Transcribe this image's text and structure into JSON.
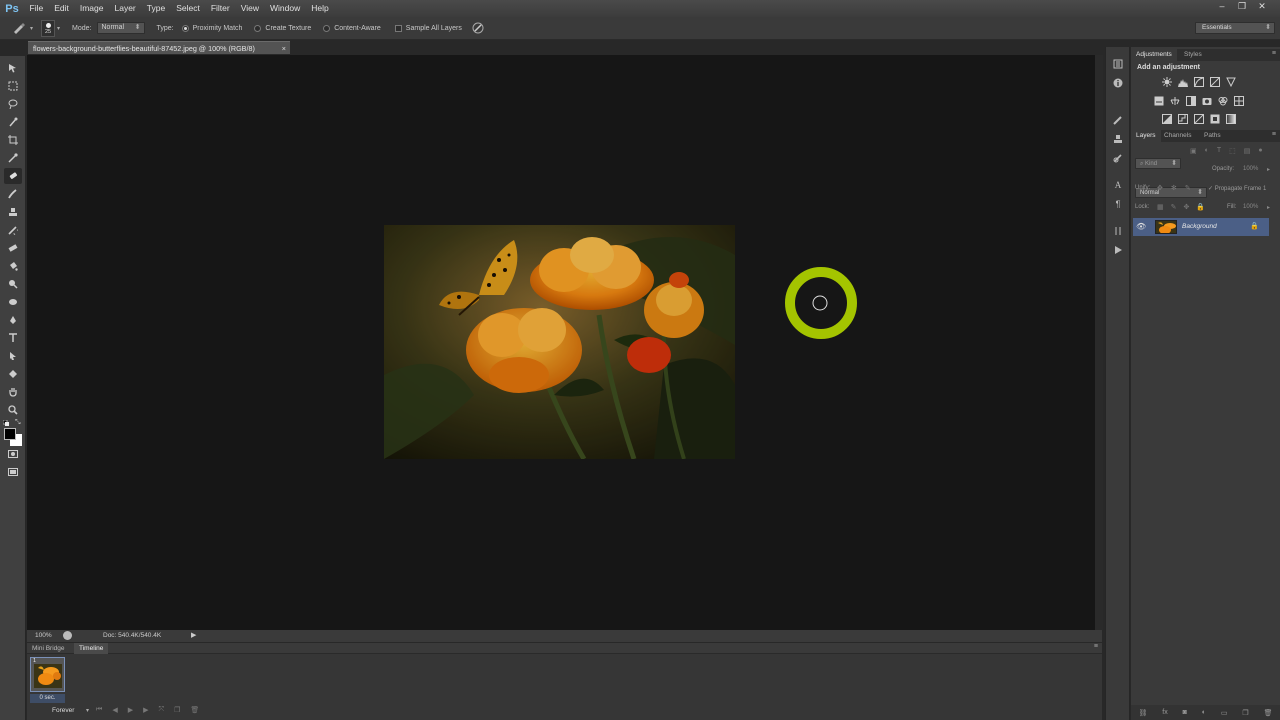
{
  "app": {
    "logo": "Ps"
  },
  "menu": [
    "File",
    "Edit",
    "Image",
    "Layer",
    "Type",
    "Select",
    "Filter",
    "View",
    "Window",
    "Help"
  ],
  "options": {
    "brush_size": "25",
    "mode_label": "Mode:",
    "mode_value": "Normal",
    "type_label": "Type:",
    "type_options": [
      "Proximity Match",
      "Create Texture",
      "Content-Aware"
    ],
    "sample_all_layers": "Sample All Layers",
    "workspace": "Essentials"
  },
  "document": {
    "tab_title": "flowers-background-butterflies-beautiful-87452.jpeg @ 100% (RGB/8)",
    "close": "×"
  },
  "status": {
    "zoom": "100%",
    "doc_size": "Doc: 540.4K/540.4K"
  },
  "bottom_panel": {
    "tabs": [
      "Mini Bridge",
      "Timeline"
    ],
    "frame_number": "1",
    "frame_delay": "0 sec.",
    "loop": "Forever"
  },
  "adjustments": {
    "tabs": [
      "Adjustments",
      "Styles"
    ],
    "heading": "Add an adjustment"
  },
  "layers": {
    "tabs": [
      "Layers",
      "Channels",
      "Paths"
    ],
    "kind": "Kind",
    "blend_mode": "Normal",
    "opacity_label": "Opacity:",
    "opacity_value": "100%",
    "unify_label": "Unify:",
    "propagate": "Propagate Frame 1",
    "lock_label": "Lock:",
    "fill_label": "Fill:",
    "fill_value": "100%",
    "items": [
      {
        "name": "Background"
      }
    ]
  },
  "colors": {
    "ring": "#a4c400",
    "layer_selected": "#4b5f86",
    "canvas": "#161616"
  }
}
